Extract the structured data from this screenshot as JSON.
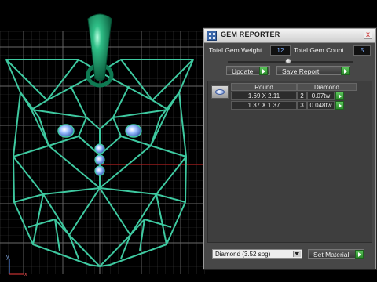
{
  "panel": {
    "title": "GEM REPORTER",
    "close_label": "x",
    "total_weight_label": "Total Gem Weight",
    "total_weight_value": "12",
    "total_count_label": "Total Gem Count",
    "total_count_value": "5",
    "update_label": "Update",
    "save_report_label": "Save Report",
    "table": {
      "headers": [
        "Round",
        "Diamond"
      ],
      "rows": [
        {
          "size": "1.69 X 2.11",
          "count": "2",
          "weight": "0.07tw"
        },
        {
          "size": "1.37 X 1.37",
          "count": "3",
          "weight": "0.048tw"
        }
      ]
    },
    "material_select_value": "Diamond   (3.52 spg)",
    "set_material_label": "Set Material"
  },
  "viewport": {
    "axis_x_label": "x",
    "axis_y_label": "y"
  },
  "colors": {
    "wireframe": "#3ec9a0",
    "bail": "#0e7a52",
    "gem_blue": "#6f98e8",
    "grid": "#5a5a5a",
    "panel_bg": "#474747",
    "value_text": "#7fb0ff",
    "go_button": "#2b8a2b"
  },
  "icons": [
    "app-logo-icon",
    "close-icon",
    "go-arrow-icon",
    "dropdown-arrow-icon",
    "gem-thumbnail-icon"
  ]
}
